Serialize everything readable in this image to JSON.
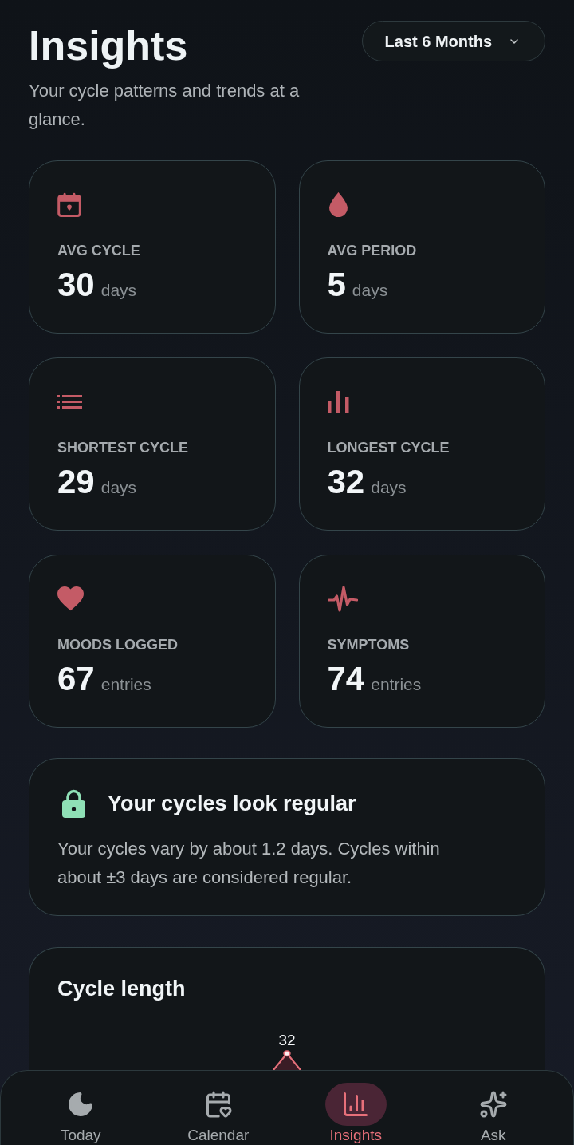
{
  "header": {
    "title": "Insights",
    "subtitle": "Your cycle patterns and trends at a glance.",
    "range_select": {
      "value": "Last 6 Months"
    }
  },
  "stats": [
    {
      "label": "AVG CYCLE",
      "value": "30",
      "unit": "days"
    },
    {
      "label": "AVG PERIOD",
      "value": "5",
      "unit": "days"
    },
    {
      "label": "SHORTEST CYCLE",
      "value": "29",
      "unit": "days"
    },
    {
      "label": "LONGEST CYCLE",
      "value": "32",
      "unit": "days"
    },
    {
      "label": "MOODS LOGGED",
      "value": "67",
      "unit": "entries"
    },
    {
      "label": "SYMPTOMS",
      "value": "74",
      "unit": "entries"
    }
  ],
  "regularity": {
    "title": "Your cycles look regular",
    "body": "Your cycles vary by about 1.2 days. Cycles within about ±3 days are considered regular."
  },
  "cycle_length": {
    "title": "Cycle length",
    "point_label": "32"
  },
  "nav": [
    {
      "label": "Today",
      "selected": false
    },
    {
      "label": "Calendar",
      "selected": false
    },
    {
      "label": "Insights",
      "selected": true
    },
    {
      "label": "Ask",
      "selected": false
    }
  ]
}
